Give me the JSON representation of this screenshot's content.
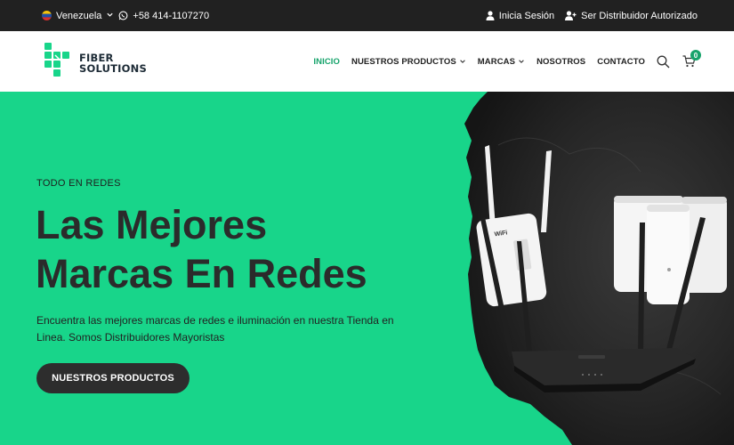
{
  "topbar": {
    "country": "Venezuela",
    "phone": "+58 414-1107270",
    "login": "Inicia Sesión",
    "distributor": "Ser Distribuidor Autorizado"
  },
  "header": {
    "logo_line1": "FIBER",
    "logo_line2": "SOLUTIONS",
    "nav": [
      {
        "label": "INICIO",
        "active": true
      },
      {
        "label": "NUESTROS PRODUCTOS",
        "dropdown": true
      },
      {
        "label": "MARCAS",
        "dropdown": true
      },
      {
        "label": "NOSOTROS"
      },
      {
        "label": "CONTACTO"
      }
    ],
    "cart_count": "0",
    "icons": [
      "search-icon",
      "cart-icon"
    ]
  },
  "hero": {
    "eyebrow": "TODO EN REDES",
    "headline_line1": "Las Mejores",
    "headline_line2": "Marcas En Redes",
    "description": "Encuentra las mejores marcas de redes e iluminación en nuestra Tienda en Linea. Somos Distribuidores Mayoristas",
    "cta_label": "NUESTROS PRODUCTOS",
    "product_labels": {
      "extender": "WiFi"
    }
  },
  "colors": {
    "brand_green": "#18d58a",
    "accent_green": "#16a36b",
    "topbar_bg": "#212121",
    "text_dark": "#2b2b2b"
  }
}
